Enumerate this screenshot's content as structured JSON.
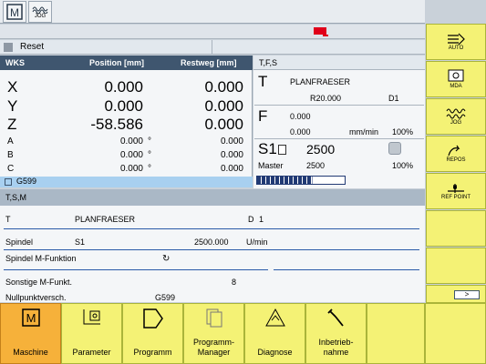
{
  "topbar": {
    "icon1": "machine-icon",
    "icon2": "jog-icon",
    "icon2_label": "JOG"
  },
  "status": {
    "reset_label": "Reset"
  },
  "wks": {
    "header": {
      "wks": "WKS",
      "position": "Position [mm]",
      "restweg": "Restweg [mm]"
    },
    "axes": [
      {
        "name": "X",
        "pos": "0.000",
        "unit": "",
        "rest": "0.000"
      },
      {
        "name": "Y",
        "pos": "0.000",
        "unit": "",
        "rest": "0.000"
      },
      {
        "name": "Z",
        "pos": "-58.586",
        "unit": "",
        "rest": "0.000"
      },
      {
        "name": "A",
        "pos": "0.000",
        "unit": "°",
        "rest": "0.000"
      },
      {
        "name": "B",
        "pos": "0.000",
        "unit": "°",
        "rest": "0.000"
      },
      {
        "name": "C",
        "pos": "0.000",
        "unit": "°",
        "rest": "0.000"
      }
    ],
    "frame": "G599"
  },
  "tfs": {
    "header": "T,F,S",
    "t_label": "T",
    "tool": "PLANFRAESER",
    "radius": "R20.000",
    "d": "D1",
    "f_label": "F",
    "f_val": "0.000",
    "f_act": "0.000",
    "f_unit": "mm/min",
    "f_pct": "100%",
    "s_label": "S1",
    "s_val": "2500",
    "master_label": "Master",
    "master_val": "2500",
    "master_pct": "100%",
    "spindle_load": 0.63
  },
  "tsm": {
    "header": "T,S,M",
    "t_label": "T",
    "tool": "PLANFRAESER",
    "d_label": "D",
    "d_val": "1",
    "spindel_label": "Spindel",
    "spindel_name": "S1",
    "spindel_speed": "2500.000",
    "spindel_unit": "U/min",
    "mfunc_label": "Spindel M-Funktion",
    "other_label": "Sonstige M-Funkt.",
    "other_val": "8",
    "nullpunkt_label": "Nullpunktversch.",
    "nullpunkt_val": "G599"
  },
  "vsoftkeys": [
    {
      "label": "AUTO",
      "icon": "auto-icon"
    },
    {
      "label": "MDA",
      "icon": "mda-icon"
    },
    {
      "label": "JOG",
      "icon": "jog-icon"
    },
    {
      "label": "REPOS",
      "icon": "repos-icon"
    },
    {
      "label": "REF POINT",
      "icon": "refpoint-icon"
    },
    {
      "label": "",
      "icon": ""
    },
    {
      "label": "",
      "icon": ""
    },
    {
      "label": "",
      "icon": ""
    }
  ],
  "more_label": ">",
  "hsoftkeys": [
    {
      "label": "Maschine",
      "icon": "machine-icon"
    },
    {
      "label": "Parameter",
      "icon": "parameter-icon"
    },
    {
      "label": "Programm",
      "icon": "program-icon"
    },
    {
      "label": "Programm-\nManager",
      "icon": "program-manager-icon"
    },
    {
      "label": "Diagnose",
      "icon": "diagnose-icon"
    },
    {
      "label": "Inbetrieb-\nnahme",
      "icon": "commissioning-icon"
    },
    {
      "label": "",
      "icon": ""
    },
    {
      "label": "",
      "icon": ""
    }
  ],
  "colors": {
    "accent": "#3f566f",
    "softkey": "#f4f275",
    "softkey_active": "#f6b13a",
    "alarm": "#e0001a"
  }
}
